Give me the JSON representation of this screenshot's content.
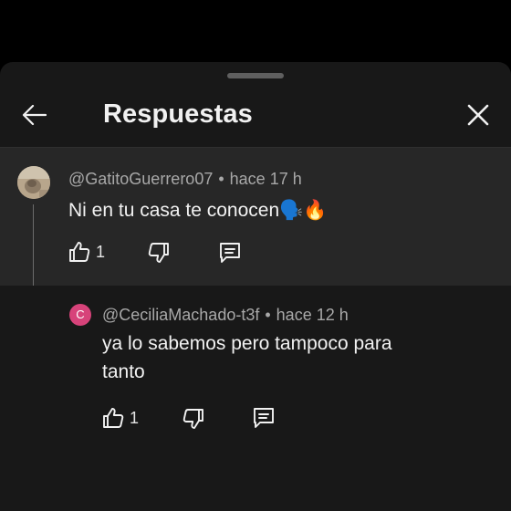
{
  "header": {
    "title": "Respuestas"
  },
  "parent_comment": {
    "handle": "@GatitoGuerrero07",
    "separator": "•",
    "time": "hace 17 h",
    "text": "Ni en tu casa te conocen🗣️🔥",
    "likes": "1"
  },
  "reply_comment": {
    "avatar_letter": "C",
    "handle": "@CeciliaMachado-t3f",
    "separator": "•",
    "time": "hace 12 h",
    "text_line1": "ya lo sabemos pero tampoco para",
    "text_line2": "tanto",
    "likes": "1"
  },
  "colors": {
    "background": "#000000",
    "sheet": "#181818",
    "parent_highlight": "#272727",
    "avatar_reply": "#d7437a"
  },
  "icons": [
    "back-arrow-icon",
    "close-icon",
    "thumbs-up-icon",
    "thumbs-down-icon",
    "reply-comment-icon"
  ]
}
